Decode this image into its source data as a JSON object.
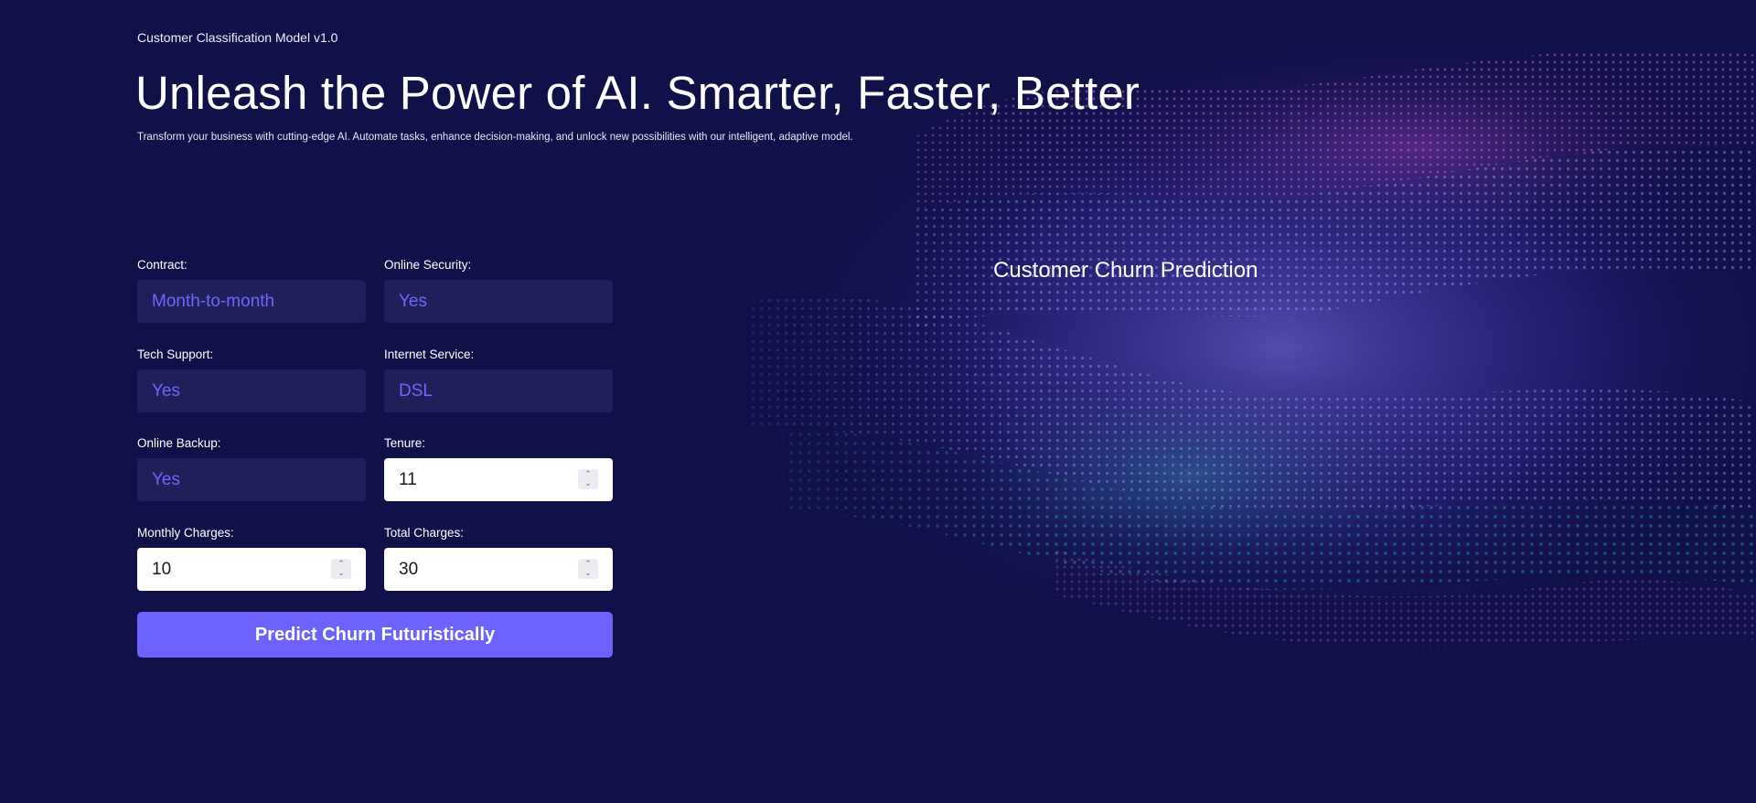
{
  "header": {
    "version_label": "Customer Classification Model v1.0",
    "headline": "Unleash the Power of AI. Smarter, Faster, Better",
    "subtext": "Transform your business with cutting-edge AI. Automate tasks, enhance decision-making, and unlock new possibilities with our intelligent, adaptive model."
  },
  "form": {
    "contract": {
      "label": "Contract:",
      "value": "Month-to-month"
    },
    "online_security": {
      "label": "Online Security:",
      "value": "Yes"
    },
    "tech_support": {
      "label": "Tech Support:",
      "value": "Yes"
    },
    "internet_service": {
      "label": "Internet Service:",
      "value": "DSL"
    },
    "online_backup": {
      "label": "Online Backup:",
      "value": "Yes"
    },
    "tenure": {
      "label": "Tenure:",
      "value": "11"
    },
    "monthly_charges": {
      "label": "Monthly Charges:",
      "value": "10"
    },
    "total_charges": {
      "label": "Total Charges:",
      "value": "30"
    },
    "submit_label": "Predict Churn Futuristically"
  },
  "result_panel": {
    "title": "Customer Churn Prediction"
  },
  "colors": {
    "background": "#11114a",
    "accent": "#6c63ff",
    "select_bg": "#1f1f5a",
    "select_text": "#6f66ff"
  }
}
